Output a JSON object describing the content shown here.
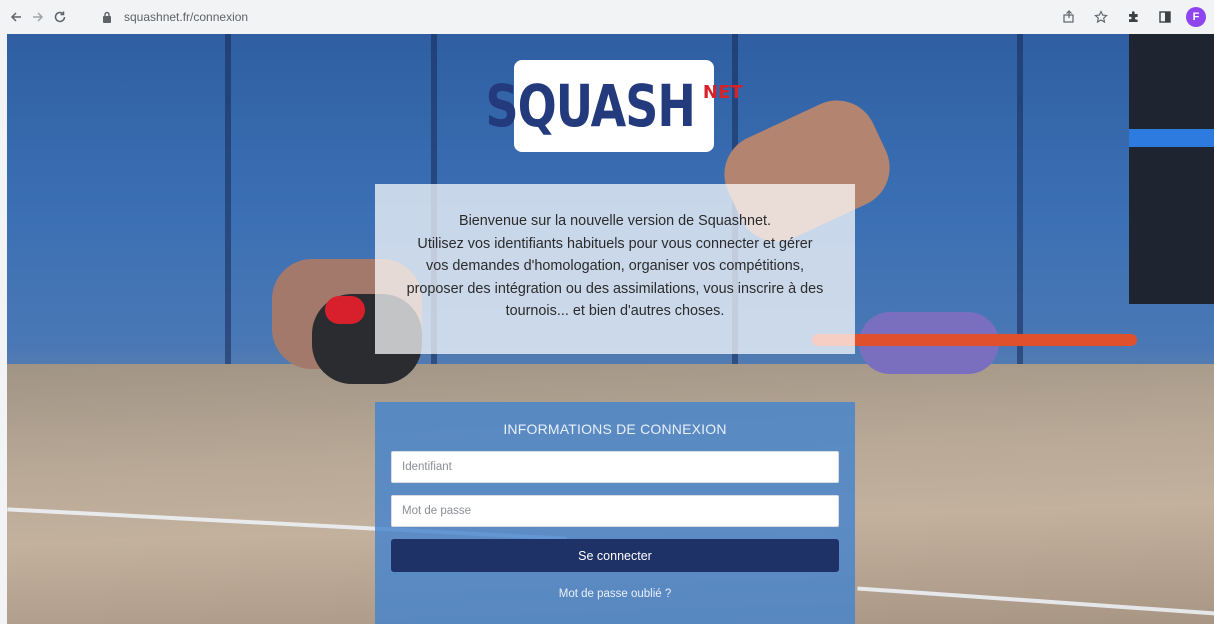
{
  "browser": {
    "url": "squashnet.fr/connexion",
    "profile_initial": "F",
    "accent_color": "#8e44ef"
  },
  "logo": {
    "main": "SQUASH",
    "suffix": "NET"
  },
  "welcome": {
    "line1": "Bienvenue sur la nouvelle version de Squashnet.",
    "line2": "Utilisez vos identifiants habituels pour vous connecter et gérer",
    "line3": "vos demandes d'homologation, organiser vos compétitions,",
    "line4": "proposer des intégration ou des assimilations, vous inscrire à des",
    "line5": "tournois... et bien d'autres choses."
  },
  "login": {
    "title": "INFORMATIONS DE CONNEXION",
    "username_placeholder": "Identifiant",
    "username_value": "",
    "password_placeholder": "Mot de passe",
    "password_value": "",
    "submit_label": "Se connecter",
    "forgot_label": "Mot de passe oublié ?",
    "panel_color": "#4684cc",
    "button_color": "#1f3268"
  }
}
